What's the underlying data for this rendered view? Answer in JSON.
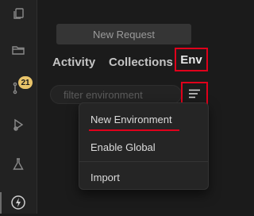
{
  "activity_bar": {
    "items": [
      {
        "icon": "copy-icon"
      },
      {
        "icon": "folder-icon"
      },
      {
        "icon": "git-branch-icon",
        "badge": "21"
      },
      {
        "icon": "run-debug-icon"
      },
      {
        "icon": "flask-icon"
      },
      {
        "icon": "lightning-icon"
      }
    ]
  },
  "panel": {
    "new_request_label": "New Request",
    "tabs": [
      {
        "label": "Activity"
      },
      {
        "label": "Collections"
      },
      {
        "label": "Env",
        "active": true
      }
    ],
    "filter": {
      "placeholder": "filter environment",
      "value": ""
    },
    "menu_icon": "menu-icon"
  },
  "dropdown": {
    "items": [
      {
        "label": "New Environment"
      },
      {
        "label": "Enable Global"
      },
      {
        "label": "Import"
      }
    ]
  },
  "colors": {
    "background": "#1b1b1b",
    "highlight_red": "#e0001b",
    "badge": "#e9c46a"
  }
}
